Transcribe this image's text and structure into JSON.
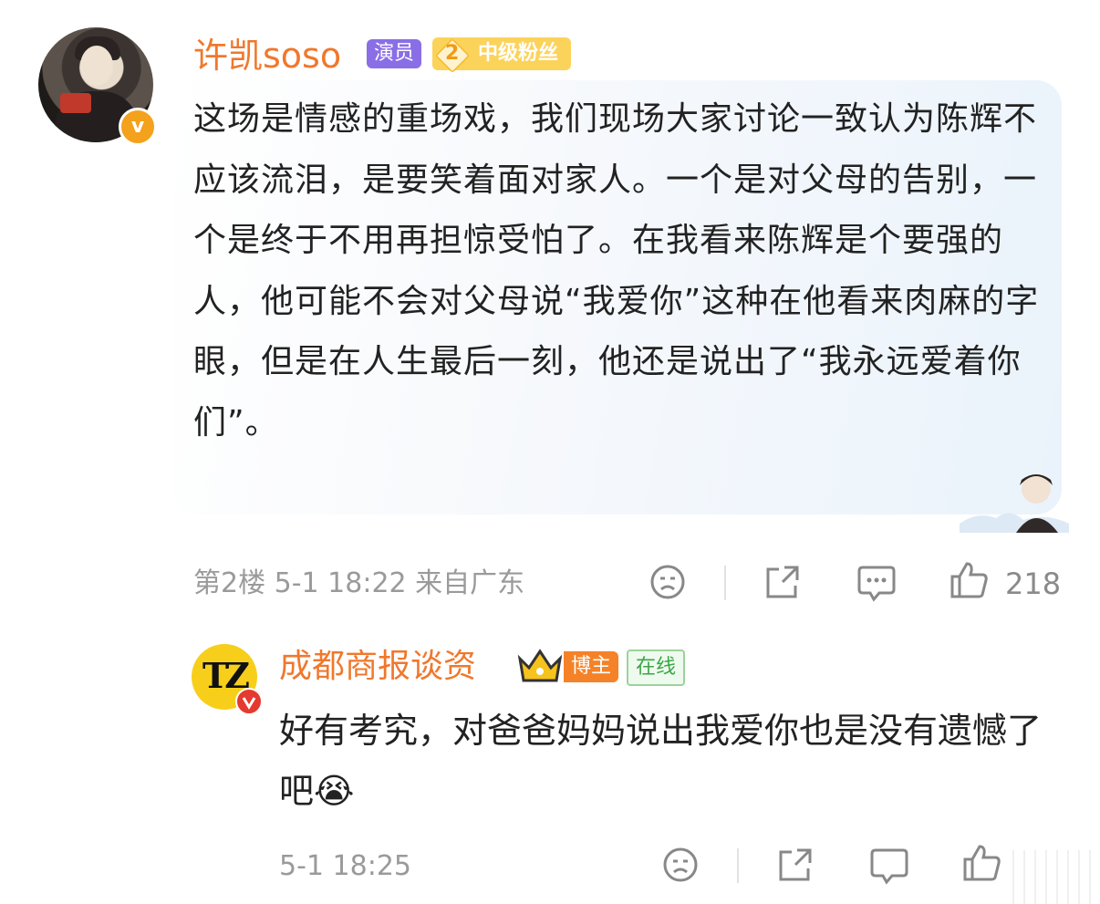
{
  "comment": {
    "username": "许凯soso",
    "badge_actor": "演员",
    "fan_level": "2",
    "fan_badge": "中级粉丝",
    "text": "这场是情感的重场戏，我们现场大家讨论一致认为陈辉不应该流泪，是要笑着面对家人。一个是对父母的告别，一个是终于不用再担惊受怕了。在我看来陈辉是个要强的人，他可能不会对父母说“我爱你”这种在他看来肉麻的字眼，但是在人生最后一刻，他还是说出了“我永远爱着你们”。",
    "floor_meta": "第2楼  5-1 18:22  来自广东",
    "like_count": "218",
    "verified_icon": "v-badge-icon"
  },
  "reply": {
    "username": "成都商报谈资",
    "badge_host": "博主",
    "badge_online": "在线",
    "avatar_text": "TZ",
    "text": "好有考究，对爸爸妈妈说出我爱你也是没有遗憾了吧",
    "emoji": "😭",
    "time": "5-1 18:25"
  },
  "colors": {
    "username": "#f0782d",
    "meta": "#9a9a9a",
    "actor_badge": "#8a6ee6",
    "fan_badge": "#fcd35a",
    "host_badge": "#f58227",
    "online_badge": "#3aa745"
  }
}
